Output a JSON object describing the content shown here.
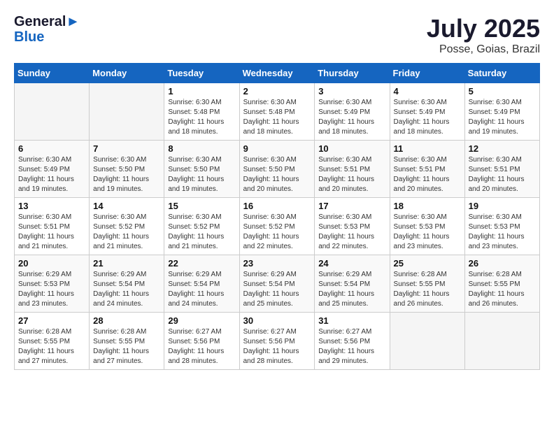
{
  "header": {
    "logo_line1": "General",
    "logo_line2": "Blue",
    "month_title": "July 2025",
    "location": "Posse, Goias, Brazil"
  },
  "days_of_week": [
    "Sunday",
    "Monday",
    "Tuesday",
    "Wednesday",
    "Thursday",
    "Friday",
    "Saturday"
  ],
  "weeks": [
    [
      {
        "day": "",
        "info": ""
      },
      {
        "day": "",
        "info": ""
      },
      {
        "day": "1",
        "info": "Sunrise: 6:30 AM\nSunset: 5:48 PM\nDaylight: 11 hours and 18 minutes."
      },
      {
        "day": "2",
        "info": "Sunrise: 6:30 AM\nSunset: 5:48 PM\nDaylight: 11 hours and 18 minutes."
      },
      {
        "day": "3",
        "info": "Sunrise: 6:30 AM\nSunset: 5:49 PM\nDaylight: 11 hours and 18 minutes."
      },
      {
        "day": "4",
        "info": "Sunrise: 6:30 AM\nSunset: 5:49 PM\nDaylight: 11 hours and 18 minutes."
      },
      {
        "day": "5",
        "info": "Sunrise: 6:30 AM\nSunset: 5:49 PM\nDaylight: 11 hours and 19 minutes."
      }
    ],
    [
      {
        "day": "6",
        "info": "Sunrise: 6:30 AM\nSunset: 5:49 PM\nDaylight: 11 hours and 19 minutes."
      },
      {
        "day": "7",
        "info": "Sunrise: 6:30 AM\nSunset: 5:50 PM\nDaylight: 11 hours and 19 minutes."
      },
      {
        "day": "8",
        "info": "Sunrise: 6:30 AM\nSunset: 5:50 PM\nDaylight: 11 hours and 19 minutes."
      },
      {
        "day": "9",
        "info": "Sunrise: 6:30 AM\nSunset: 5:50 PM\nDaylight: 11 hours and 20 minutes."
      },
      {
        "day": "10",
        "info": "Sunrise: 6:30 AM\nSunset: 5:51 PM\nDaylight: 11 hours and 20 minutes."
      },
      {
        "day": "11",
        "info": "Sunrise: 6:30 AM\nSunset: 5:51 PM\nDaylight: 11 hours and 20 minutes."
      },
      {
        "day": "12",
        "info": "Sunrise: 6:30 AM\nSunset: 5:51 PM\nDaylight: 11 hours and 20 minutes."
      }
    ],
    [
      {
        "day": "13",
        "info": "Sunrise: 6:30 AM\nSunset: 5:51 PM\nDaylight: 11 hours and 21 minutes."
      },
      {
        "day": "14",
        "info": "Sunrise: 6:30 AM\nSunset: 5:52 PM\nDaylight: 11 hours and 21 minutes."
      },
      {
        "day": "15",
        "info": "Sunrise: 6:30 AM\nSunset: 5:52 PM\nDaylight: 11 hours and 21 minutes."
      },
      {
        "day": "16",
        "info": "Sunrise: 6:30 AM\nSunset: 5:52 PM\nDaylight: 11 hours and 22 minutes."
      },
      {
        "day": "17",
        "info": "Sunrise: 6:30 AM\nSunset: 5:53 PM\nDaylight: 11 hours and 22 minutes."
      },
      {
        "day": "18",
        "info": "Sunrise: 6:30 AM\nSunset: 5:53 PM\nDaylight: 11 hours and 23 minutes."
      },
      {
        "day": "19",
        "info": "Sunrise: 6:30 AM\nSunset: 5:53 PM\nDaylight: 11 hours and 23 minutes."
      }
    ],
    [
      {
        "day": "20",
        "info": "Sunrise: 6:29 AM\nSunset: 5:53 PM\nDaylight: 11 hours and 23 minutes."
      },
      {
        "day": "21",
        "info": "Sunrise: 6:29 AM\nSunset: 5:54 PM\nDaylight: 11 hours and 24 minutes."
      },
      {
        "day": "22",
        "info": "Sunrise: 6:29 AM\nSunset: 5:54 PM\nDaylight: 11 hours and 24 minutes."
      },
      {
        "day": "23",
        "info": "Sunrise: 6:29 AM\nSunset: 5:54 PM\nDaylight: 11 hours and 25 minutes."
      },
      {
        "day": "24",
        "info": "Sunrise: 6:29 AM\nSunset: 5:54 PM\nDaylight: 11 hours and 25 minutes."
      },
      {
        "day": "25",
        "info": "Sunrise: 6:28 AM\nSunset: 5:55 PM\nDaylight: 11 hours and 26 minutes."
      },
      {
        "day": "26",
        "info": "Sunrise: 6:28 AM\nSunset: 5:55 PM\nDaylight: 11 hours and 26 minutes."
      }
    ],
    [
      {
        "day": "27",
        "info": "Sunrise: 6:28 AM\nSunset: 5:55 PM\nDaylight: 11 hours and 27 minutes."
      },
      {
        "day": "28",
        "info": "Sunrise: 6:28 AM\nSunset: 5:55 PM\nDaylight: 11 hours and 27 minutes."
      },
      {
        "day": "29",
        "info": "Sunrise: 6:27 AM\nSunset: 5:56 PM\nDaylight: 11 hours and 28 minutes."
      },
      {
        "day": "30",
        "info": "Sunrise: 6:27 AM\nSunset: 5:56 PM\nDaylight: 11 hours and 28 minutes."
      },
      {
        "day": "31",
        "info": "Sunrise: 6:27 AM\nSunset: 5:56 PM\nDaylight: 11 hours and 29 minutes."
      },
      {
        "day": "",
        "info": ""
      },
      {
        "day": "",
        "info": ""
      }
    ]
  ]
}
